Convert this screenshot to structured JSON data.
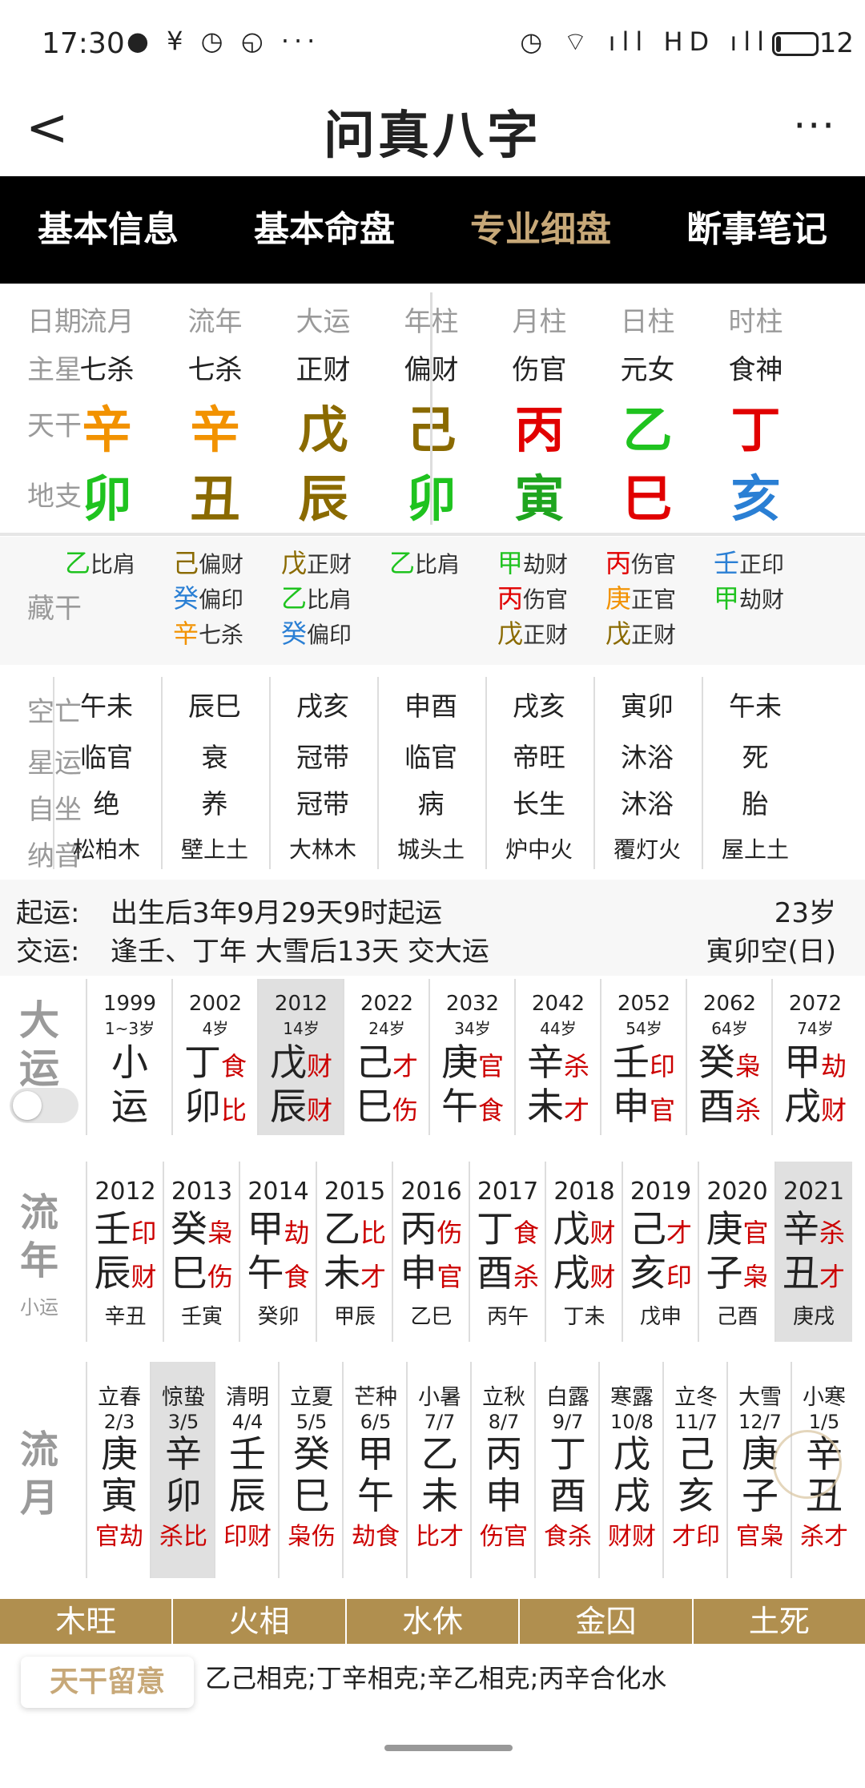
{
  "status": {
    "time": "17:30",
    "left_icons": "● ¥ ◷ ◵ ···",
    "right_icons": "◷ ⌔ ıll HD ıll",
    "battery_level": 0.12,
    "battery_text": "12"
  },
  "header": {
    "title": "问真八字",
    "back": "<",
    "more": "···"
  },
  "tabs": [
    {
      "label": "基本信息",
      "active": false
    },
    {
      "label": "基本命盘",
      "active": false
    },
    {
      "label": "专业细盘",
      "active": true
    },
    {
      "label": "断事笔记",
      "active": false
    }
  ],
  "main": {
    "row_labels": [
      "日期",
      "主星",
      "天干",
      "地支"
    ],
    "columns": [
      {
        "hdr": "流月",
        "star": "七杀",
        "gan": "辛",
        "gan_color": "#f29200",
        "zhi": "卯",
        "zhi_color": "#1fc31f"
      },
      {
        "hdr": "流年",
        "star": "七杀",
        "gan": "辛",
        "gan_color": "#f29200",
        "zhi": "丑",
        "zhi_color": "#8a6a00"
      },
      {
        "hdr": "大运",
        "star": "正财",
        "gan": "戊",
        "gan_color": "#8a6a00",
        "zhi": "辰",
        "zhi_color": "#8a6a00"
      },
      {
        "hdr": "年柱",
        "star": "偏财",
        "gan": "己",
        "gan_color": "#8a6a00",
        "zhi": "卯",
        "zhi_color": "#1fc31f"
      },
      {
        "hdr": "月柱",
        "star": "伤官",
        "gan": "丙",
        "gan_color": "#e10000",
        "zhi": "寅",
        "zhi_color": "#1fa51f"
      },
      {
        "hdr": "日柱",
        "star": "元女",
        "gan": "乙",
        "gan_color": "#1fc31f",
        "zhi": "巳",
        "zhi_color": "#e10000"
      },
      {
        "hdr": "时柱",
        "star": "食神",
        "gan": "丁",
        "gan_color": "#e10000",
        "zhi": "亥",
        "zhi_color": "#2a7fd4"
      }
    ]
  },
  "canggan": {
    "label": "藏干",
    "columns": [
      [
        {
          "g": "乙",
          "c": "#1fc31f",
          "t": "比肩"
        }
      ],
      [
        {
          "g": "己",
          "c": "#8a6a00",
          "t": "偏财"
        },
        {
          "g": "癸",
          "c": "#2a7fd4",
          "t": "偏印"
        },
        {
          "g": "辛",
          "c": "#f29200",
          "t": "七杀"
        }
      ],
      [
        {
          "g": "戊",
          "c": "#8a6a00",
          "t": "正财"
        },
        {
          "g": "乙",
          "c": "#1fc31f",
          "t": "比肩"
        },
        {
          "g": "癸",
          "c": "#2a7fd4",
          "t": "偏印"
        }
      ],
      [
        {
          "g": "乙",
          "c": "#1fc31f",
          "t": "比肩"
        }
      ],
      [
        {
          "g": "甲",
          "c": "#1fc31f",
          "t": "劫财"
        },
        {
          "g": "丙",
          "c": "#e10000",
          "t": "伤官"
        },
        {
          "g": "戊",
          "c": "#8a6a00",
          "t": "正财"
        }
      ],
      [
        {
          "g": "丙",
          "c": "#e10000",
          "t": "伤官"
        },
        {
          "g": "庚",
          "c": "#f29200",
          "t": "正官"
        },
        {
          "g": "戊",
          "c": "#8a6a00",
          "t": "正财"
        }
      ],
      [
        {
          "g": "壬",
          "c": "#2a7fd4",
          "t": "正印"
        },
        {
          "g": "甲",
          "c": "#1fc31f",
          "t": "劫财"
        }
      ]
    ]
  },
  "kongwang": {
    "row_labels": [
      "空亡",
      "星运",
      "自坐",
      "纳音"
    ],
    "columns": [
      [
        "午未",
        "临官",
        "绝",
        "松柏木"
      ],
      [
        "辰巳",
        "衰",
        "养",
        "壁上土"
      ],
      [
        "戌亥",
        "冠带",
        "冠带",
        "大林木"
      ],
      [
        "申酉",
        "临官",
        "病",
        "城头土"
      ],
      [
        "戌亥",
        "帝旺",
        "长生",
        "炉中火"
      ],
      [
        "寅卯",
        "沐浴",
        "沐浴",
        "覆灯火"
      ],
      [
        "午未",
        "死",
        "胎",
        "屋上土"
      ]
    ]
  },
  "qiyun": {
    "label1": "起运:",
    "text1": "出生后3年9月29天9时起运",
    "age": "23岁",
    "label2": "交运:",
    "text2": "逢壬、丁年 大雪后13天 交大运",
    "kong": "寅卯空(日)"
  },
  "dayun": {
    "label": "大运",
    "items": [
      {
        "yr": "1999",
        "age": "1~3岁",
        "g": "小",
        "gs": "",
        "z": "运",
        "zs": "",
        "sel": false
      },
      {
        "yr": "2002",
        "age": "4岁",
        "g": "丁",
        "gs": "食",
        "z": "卯",
        "zs": "比",
        "sel": false
      },
      {
        "yr": "2012",
        "age": "14岁",
        "g": "戊",
        "gs": "财",
        "z": "辰",
        "zs": "财",
        "sel": true
      },
      {
        "yr": "2022",
        "age": "24岁",
        "g": "己",
        "gs": "才",
        "z": "巳",
        "zs": "伤",
        "sel": false
      },
      {
        "yr": "2032",
        "age": "34岁",
        "g": "庚",
        "gs": "官",
        "z": "午",
        "zs": "食",
        "sel": false
      },
      {
        "yr": "2042",
        "age": "44岁",
        "g": "辛",
        "gs": "杀",
        "z": "未",
        "zs": "才",
        "sel": false
      },
      {
        "yr": "2052",
        "age": "54岁",
        "g": "壬",
        "gs": "印",
        "z": "申",
        "zs": "官",
        "sel": false
      },
      {
        "yr": "2062",
        "age": "64岁",
        "g": "癸",
        "gs": "枭",
        "z": "酉",
        "zs": "杀",
        "sel": false
      },
      {
        "yr": "2072",
        "age": "74岁",
        "g": "甲",
        "gs": "劫",
        "z": "戌",
        "zs": "财",
        "sel": false
      }
    ]
  },
  "liunian": {
    "label": "流年",
    "sublabel": "小运",
    "items": [
      {
        "yr": "2012",
        "g": "壬",
        "gs": "印",
        "z": "辰",
        "zs": "财",
        "xy": "辛丑",
        "sel": false
      },
      {
        "yr": "2013",
        "g": "癸",
        "gs": "枭",
        "z": "巳",
        "zs": "伤",
        "xy": "壬寅",
        "sel": false
      },
      {
        "yr": "2014",
        "g": "甲",
        "gs": "劫",
        "z": "午",
        "zs": "食",
        "xy": "癸卯",
        "sel": false
      },
      {
        "yr": "2015",
        "g": "乙",
        "gs": "比",
        "z": "未",
        "zs": "才",
        "xy": "甲辰",
        "sel": false
      },
      {
        "yr": "2016",
        "g": "丙",
        "gs": "伤",
        "z": "申",
        "zs": "官",
        "xy": "乙巳",
        "sel": false
      },
      {
        "yr": "2017",
        "g": "丁",
        "gs": "食",
        "z": "酉",
        "zs": "杀",
        "xy": "丙午",
        "sel": false
      },
      {
        "yr": "2018",
        "g": "戊",
        "gs": "财",
        "z": "戌",
        "zs": "财",
        "xy": "丁未",
        "sel": false
      },
      {
        "yr": "2019",
        "g": "己",
        "gs": "才",
        "z": "亥",
        "zs": "印",
        "xy": "戊申",
        "sel": false
      },
      {
        "yr": "2020",
        "g": "庚",
        "gs": "官",
        "z": "子",
        "zs": "枭",
        "xy": "己酉",
        "sel": false
      },
      {
        "yr": "2021",
        "g": "辛",
        "gs": "杀",
        "z": "丑",
        "zs": "才",
        "xy": "庚戌",
        "sel": true
      }
    ]
  },
  "liuyue": {
    "label": "流月",
    "items": [
      {
        "jq": "立春",
        "dt": "2/3",
        "g": "庚",
        "z": "寅",
        "ss": "官劫",
        "sel": false
      },
      {
        "jq": "惊蛰",
        "dt": "3/5",
        "g": "辛",
        "z": "卯",
        "ss": "杀比",
        "sel": true
      },
      {
        "jq": "清明",
        "dt": "4/4",
        "g": "壬",
        "z": "辰",
        "ss": "印财",
        "sel": false
      },
      {
        "jq": "立夏",
        "dt": "5/5",
        "g": "癸",
        "z": "巳",
        "ss": "枭伤",
        "sel": false
      },
      {
        "jq": "芒种",
        "dt": "6/5",
        "g": "甲",
        "z": "午",
        "ss": "劫食",
        "sel": false
      },
      {
        "jq": "小暑",
        "dt": "7/7",
        "g": "乙",
        "z": "未",
        "ss": "比才",
        "sel": false
      },
      {
        "jq": "立秋",
        "dt": "8/7",
        "g": "丙",
        "z": "申",
        "ss": "伤官",
        "sel": false
      },
      {
        "jq": "白露",
        "dt": "9/7",
        "g": "丁",
        "z": "酉",
        "ss": "食杀",
        "sel": false
      },
      {
        "jq": "寒露",
        "dt": "10/8",
        "g": "戊",
        "z": "戌",
        "ss": "财财",
        "sel": false
      },
      {
        "jq": "立冬",
        "dt": "11/7",
        "g": "己",
        "z": "亥",
        "ss": "才印",
        "sel": false
      },
      {
        "jq": "大雪",
        "dt": "12/7",
        "g": "庚",
        "z": "子",
        "ss": "官枭",
        "sel": false
      },
      {
        "jq": "小寒",
        "dt": "1/5",
        "g": "辛",
        "z": "丑",
        "ss": "杀才",
        "sel": false
      }
    ]
  },
  "wuxing": [
    "木旺",
    "火相",
    "水休",
    "金囚",
    "土死"
  ],
  "note": {
    "button": "天干留意",
    "text": "乙己相克;丁辛相克;辛乙相克;丙辛合化水"
  }
}
